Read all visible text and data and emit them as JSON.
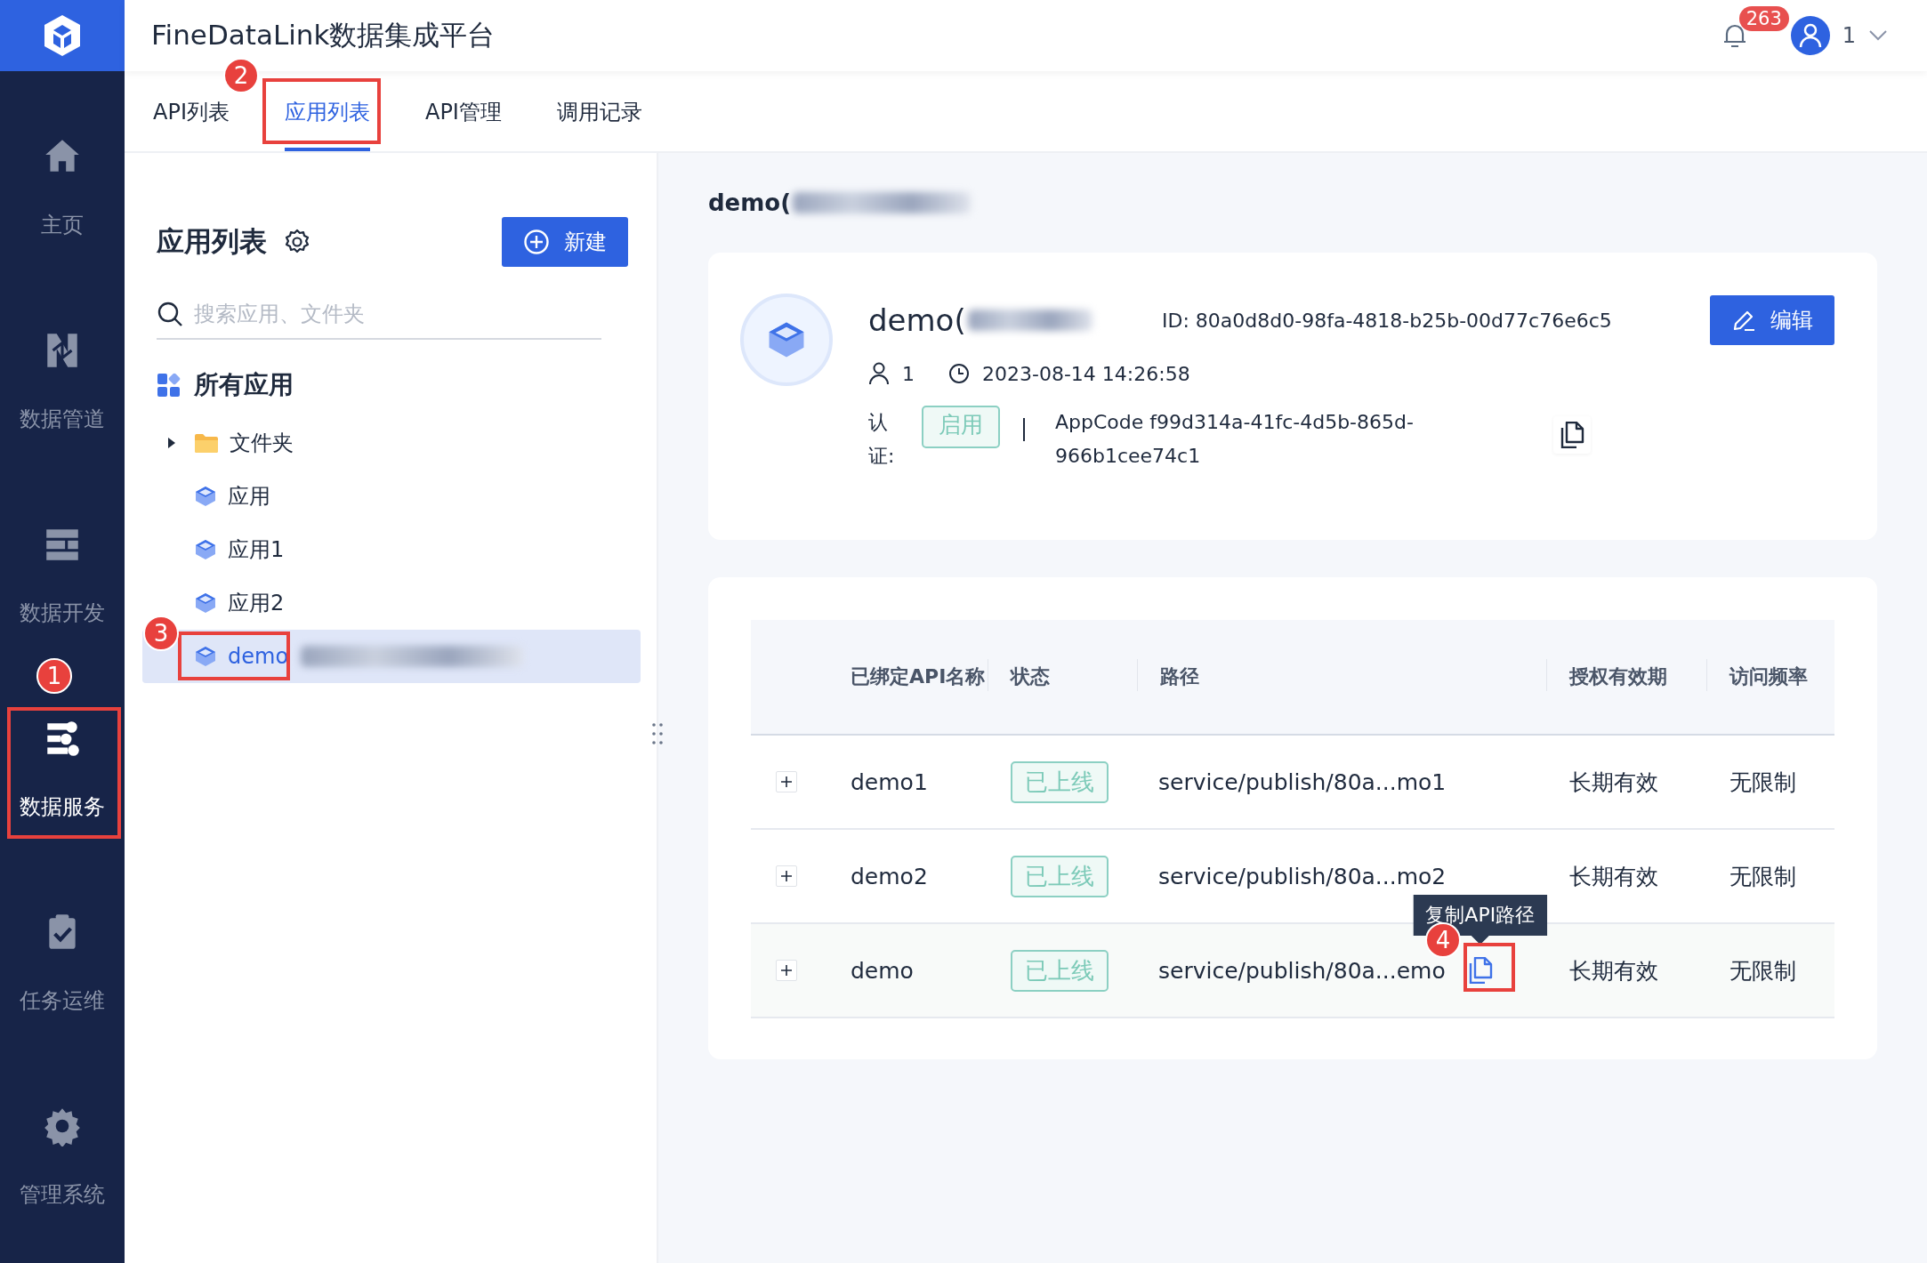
{
  "app": {
    "title": "FineDataLink数据集成平台"
  },
  "header": {
    "notification_count": "263",
    "user": "1"
  },
  "nav": [
    {
      "label": "主页",
      "selected": false
    },
    {
      "label": "数据管道",
      "selected": false
    },
    {
      "label": "数据开发",
      "selected": false
    },
    {
      "label": "数据服务",
      "selected": true
    },
    {
      "label": "任务运维",
      "selected": false
    },
    {
      "label": "管理系统",
      "selected": false
    }
  ],
  "tabs": [
    {
      "label": "API列表",
      "selected": false
    },
    {
      "label": "应用列表",
      "selected": true
    },
    {
      "label": "API管理",
      "selected": false
    },
    {
      "label": "调用记录",
      "selected": false
    }
  ],
  "app_panel": {
    "title": "应用列表",
    "new_button": "新建",
    "search": {
      "placeholder": "搜索应用、文件夹"
    },
    "root": "所有应用",
    "tree": [
      {
        "label": "文件夹",
        "kind": "folder",
        "expanded": false,
        "selected": false,
        "redacted": false
      },
      {
        "label": "应用",
        "kind": "app",
        "selected": false,
        "redacted": false
      },
      {
        "label": "应用1",
        "kind": "app",
        "selected": false,
        "redacted": false
      },
      {
        "label": "应用2",
        "kind": "app",
        "selected": false,
        "redacted": false
      },
      {
        "label": "demo",
        "kind": "app",
        "selected": true,
        "redacted": true
      }
    ]
  },
  "detail": {
    "heading": "demo(",
    "heading_redacted": true,
    "name": "demo(",
    "name_redacted": true,
    "id": "ID: 80a0d8d0-98fa-4818-b25b-00d77c76e6c5",
    "edit_button": "编辑",
    "owner": "1",
    "created": "2023-08-14 14:26:58",
    "auth_label": "认证:",
    "auth_status": "启用",
    "app_code": "AppCode f99d314a-41fc-4d5b-865d-966b1cee74c1"
  },
  "table": {
    "columns": [
      "已绑定API名称",
      "状态",
      "路径",
      "授权有效期",
      "访问频率"
    ],
    "tooltip": "复制API路径",
    "rows": [
      {
        "name": "demo1",
        "status": "已上线",
        "path": "service/publish/80a...mo1",
        "validity": "长期有效",
        "rate": "无限制",
        "hovered": false
      },
      {
        "name": "demo2",
        "status": "已上线",
        "path": "service/publish/80a...mo2",
        "validity": "长期有效",
        "rate": "无限制",
        "hovered": false
      },
      {
        "name": "demo",
        "status": "已上线",
        "path": "service/publish/80a...emo",
        "validity": "长期有效",
        "rate": "无限制",
        "hovered": true
      }
    ]
  },
  "annotations": [
    {
      "label": "1"
    },
    {
      "label": "2"
    },
    {
      "label": "3"
    },
    {
      "label": "4"
    }
  ]
}
